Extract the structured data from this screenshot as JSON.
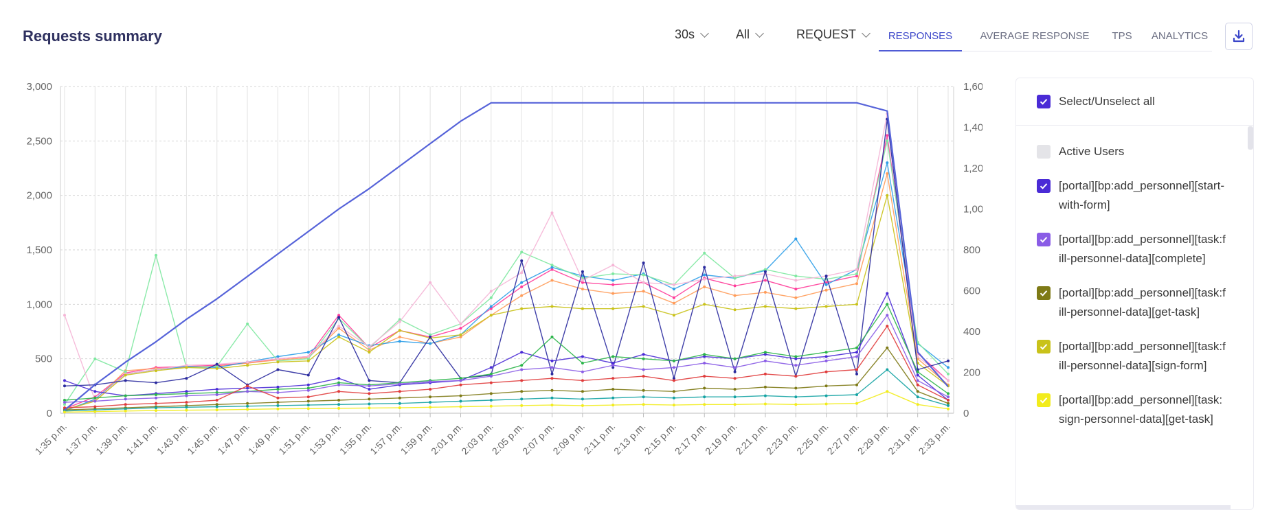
{
  "header": {
    "title": "Requests summary",
    "dropdowns": [
      {
        "value": "30s"
      },
      {
        "value": "All"
      },
      {
        "value": "REQUEST"
      }
    ],
    "tabs": [
      "RESPONSES",
      "AVERAGE RESPONSE",
      "TPS",
      "ANALYTICS"
    ],
    "active_tab": "RESPONSES"
  },
  "legend": {
    "select_all_label": "Select/Unselect all",
    "items": [
      {
        "label": "Active Users",
        "checked": false,
        "color": "#e4e4e8"
      },
      {
        "label": "[portal][bp:add_personnel][start-with-form]",
        "checked": true,
        "color": "#4a2bd6"
      },
      {
        "label": "[portal][bp:add_personnel][task:fill-personnel-data][complete]",
        "checked": true,
        "color": "#8a5ce6"
      },
      {
        "label": "[portal][bp:add_personnel][task:fill-personnel-data][get-task]",
        "checked": true,
        "color": "#7e7a16"
      },
      {
        "label": "[portal][bp:add_personnel][task:fill-personnel-data][sign-form]",
        "checked": true,
        "color": "#c9c21a"
      },
      {
        "label": "[portal][bp:add_personnel][task:sign-personnel-data][get-task]",
        "checked": true,
        "color": "#f2ec1c"
      }
    ]
  },
  "chart_data": {
    "type": "line",
    "x": [
      "1:35 p.m.",
      "1:37 p.m.",
      "1:39 p.m.",
      "1:41 p.m.",
      "1:43 p.m.",
      "1:45 p.m.",
      "1:47 p.m.",
      "1:49 p.m.",
      "1:51 p.m.",
      "1:53 p.m.",
      "1:55 p.m.",
      "1:57 p.m.",
      "1:59 p.m.",
      "2:01 p.m.",
      "2:03 p.m.",
      "2:05 p.m.",
      "2:07 p.m.",
      "2:09 p.m.",
      "2:11 p.m.",
      "2:13 p.m.",
      "2:15 p.m.",
      "2:17 p.m.",
      "2:19 p.m.",
      "2:21 p.m.",
      "2:23 p.m.",
      "2:25 p.m.",
      "2:27 p.m.",
      "2:29 p.m.",
      "2:31 p.m.",
      "2:33 p.m."
    ],
    "y_left": {
      "ylim": [
        0,
        3000
      ],
      "ticks": [
        "0",
        "500",
        "1,000",
        "1,500",
        "2,000",
        "2,500",
        "3,000"
      ]
    },
    "y_right": {
      "ylim": [
        0,
        1600
      ],
      "ticks": [
        "0",
        "200",
        "400",
        "600",
        "800",
        "1,000",
        "1,200",
        "1,400",
        "1,600"
      ]
    },
    "grid": true,
    "series": [
      {
        "axis": "right",
        "color": "#5663d9",
        "values": [
          15,
          140,
          250,
          350,
          460,
          560,
          670,
          780,
          890,
          1000,
          1100,
          1210,
          1320,
          1430,
          1520,
          1520,
          1520,
          1520,
          1520,
          1520,
          1520,
          1520,
          1520,
          1520,
          1520,
          1520,
          1520,
          1480,
          300,
          130
        ]
      },
      {
        "axis": "left",
        "color": "#ff3d9a",
        "values": [
          40,
          150,
          370,
          420,
          430,
          440,
          460,
          500,
          520,
          900,
          600,
          760,
          700,
          780,
          960,
          1160,
          1320,
          1200,
          1180,
          1200,
          1060,
          1240,
          1170,
          1220,
          1140,
          1200,
          1260,
          2550,
          550,
          300
        ]
      },
      {
        "axis": "left",
        "color": "#ff9c5a",
        "values": [
          30,
          120,
          390,
          410,
          420,
          430,
          460,
          490,
          510,
          780,
          580,
          700,
          640,
          700,
          900,
          1080,
          1220,
          1140,
          1100,
          1120,
          1010,
          1160,
          1080,
          1110,
          1060,
          1130,
          1190,
          2200,
          500,
          260
        ]
      },
      {
        "axis": "left",
        "color": "#2e9ee8",
        "values": [
          20,
          130,
          360,
          400,
          430,
          420,
          470,
          520,
          560,
          720,
          620,
          660,
          640,
          720,
          980,
          1200,
          1340,
          1260,
          1220,
          1280,
          1140,
          1270,
          1240,
          1310,
          1600,
          1180,
          1320,
          2300,
          640,
          420
        ]
      },
      {
        "axis": "left",
        "color": "#7ee8a0",
        "values": [
          80,
          500,
          380,
          1450,
          420,
          430,
          820,
          480,
          500,
          870,
          600,
          860,
          720,
          820,
          1060,
          1480,
          1360,
          1240,
          1280,
          1270,
          1180,
          1470,
          1240,
          1320,
          1260,
          1230,
          1280,
          2500,
          650,
          360
        ]
      },
      {
        "axis": "left",
        "color": "#f5b5d6",
        "values": [
          900,
          120,
          360,
          400,
          440,
          450,
          470,
          500,
          520,
          800,
          610,
          840,
          1200,
          820,
          1120,
          1290,
          1840,
          1220,
          1360,
          1200,
          1180,
          1230,
          1260,
          1280,
          1220,
          1260,
          1320,
          2750,
          520,
          300
        ]
      },
      {
        "axis": "left",
        "color": "#c9c21a",
        "values": [
          30,
          110,
          350,
          390,
          420,
          410,
          440,
          470,
          480,
          700,
          560,
          760,
          690,
          720,
          900,
          960,
          980,
          960,
          960,
          980,
          900,
          1000,
          950,
          980,
          960,
          980,
          1000,
          2000,
          460,
          250
        ]
      },
      {
        "axis": "left",
        "color": "#2a2a9e",
        "values": [
          250,
          260,
          300,
          280,
          320,
          450,
          260,
          400,
          350,
          880,
          300,
          280,
          700,
          320,
          350,
          1400,
          360,
          1300,
          420,
          1380,
          320,
          1340,
          380,
          1300,
          340,
          1260,
          360,
          2700,
          400,
          480
        ]
      },
      {
        "axis": "left",
        "color": "#4a2bd6",
        "values": [
          300,
          200,
          160,
          180,
          200,
          220,
          230,
          240,
          260,
          320,
          220,
          260,
          280,
          300,
          420,
          560,
          480,
          520,
          460,
          540,
          480,
          520,
          500,
          540,
          500,
          520,
          560,
          1100,
          350,
          120
        ]
      },
      {
        "axis": "left",
        "color": "#2bb54a",
        "values": [
          120,
          140,
          160,
          170,
          180,
          190,
          200,
          220,
          230,
          280,
          260,
          280,
          300,
          320,
          360,
          440,
          700,
          460,
          520,
          500,
          480,
          540,
          500,
          560,
          520,
          560,
          600,
          1000,
          380,
          180
        ]
      },
      {
        "axis": "left",
        "color": "#8a5ce6",
        "values": [
          100,
          110,
          130,
          140,
          160,
          170,
          200,
          190,
          210,
          260,
          250,
          270,
          290,
          300,
          340,
          400,
          420,
          380,
          440,
          400,
          420,
          460,
          420,
          480,
          440,
          480,
          520,
          900,
          300,
          150
        ]
      },
      {
        "axis": "left",
        "color": "#e03b3b",
        "values": [
          50,
          60,
          80,
          90,
          100,
          120,
          250,
          140,
          150,
          200,
          180,
          200,
          220,
          260,
          280,
          300,
          320,
          300,
          320,
          340,
          300,
          340,
          320,
          360,
          340,
          380,
          400,
          800,
          260,
          120
        ]
      },
      {
        "axis": "left",
        "color": "#7e7a16",
        "values": [
          30,
          40,
          50,
          60,
          70,
          80,
          90,
          100,
          110,
          120,
          130,
          140,
          150,
          160,
          180,
          200,
          210,
          200,
          220,
          210,
          200,
          230,
          220,
          240,
          230,
          250,
          260,
          600,
          200,
          90
        ]
      },
      {
        "axis": "left",
        "color": "#14a3a3",
        "values": [
          20,
          30,
          40,
          50,
          55,
          60,
          65,
          70,
          75,
          80,
          85,
          90,
          100,
          110,
          120,
          130,
          140,
          130,
          140,
          150,
          140,
          150,
          150,
          160,
          150,
          160,
          170,
          400,
          150,
          70
        ]
      },
      {
        "axis": "left",
        "color": "#f2ec1c",
        "values": [
          10,
          15,
          20,
          25,
          28,
          30,
          35,
          40,
          42,
          45,
          48,
          50,
          55,
          60,
          65,
          70,
          75,
          70,
          75,
          80,
          75,
          80,
          80,
          85,
          80,
          85,
          90,
          200,
          80,
          40
        ]
      }
    ]
  }
}
